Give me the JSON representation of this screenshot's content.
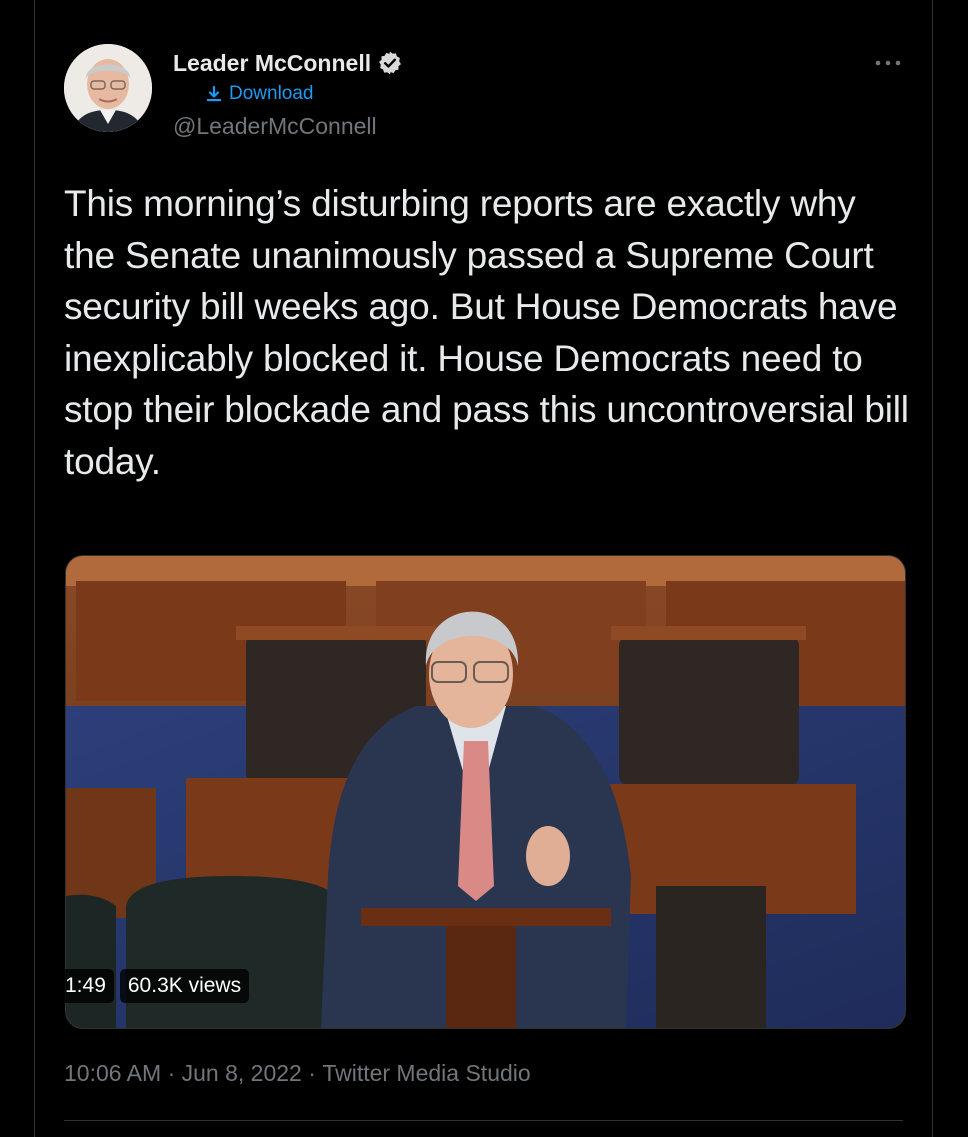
{
  "author": {
    "name": "Leader McConnell",
    "handle": "@LeaderMcConnell",
    "verified_icon": "verified-badge-icon"
  },
  "download_label": "Download",
  "more_icon": "more-options-icon",
  "tweet": {
    "text": "This morning’s disturbing reports are exactly why the Senate unanimously passed a Supreme Court security bill weeks ago. But House Democrats have inexplicably blocked it. House Democrats need to stop their blockade and pass this uncontroversial bill today."
  },
  "video": {
    "duration": "1:49",
    "views": "60.3K views"
  },
  "meta": {
    "time": "10:06 AM",
    "separator": " · ",
    "date": "Jun 8, 2022",
    "source": "Twitter Media Studio"
  },
  "colors": {
    "background": "#000000",
    "text": "#e7e9ea",
    "muted": "#71767b",
    "link": "#1d9bf0",
    "divider": "#2f3336"
  }
}
